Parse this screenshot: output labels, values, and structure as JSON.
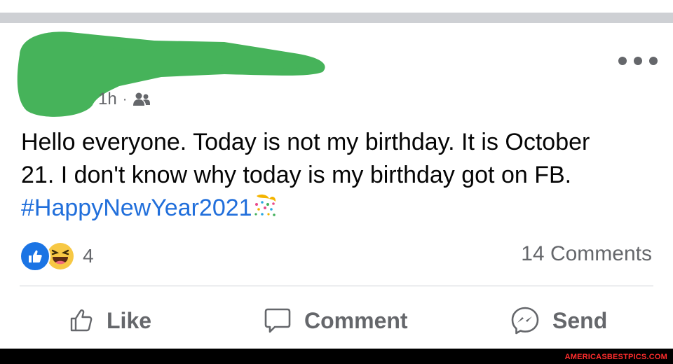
{
  "post": {
    "time": "1h",
    "separator": "·",
    "audience_icon": "friends-icon",
    "text_line1": "Hello everyone. Today is not my birthday. It is October",
    "text_line2": "21. I don't know why today is my birthday got on FB.",
    "hashtag": "#HappyNewYear2021",
    "hashtag_emoji": "confetti-icon"
  },
  "reactions": {
    "types": [
      "like",
      "haha"
    ],
    "count": "4"
  },
  "comments": {
    "count_label": "14 Comments"
  },
  "actions": {
    "like_label": "Like",
    "comment_label": "Comment",
    "send_label": "Send"
  },
  "watermark": "AMERICASBESTPICS.COM",
  "colors": {
    "link": "#216fdb",
    "secondary_text": "#65676b",
    "divider": "#ced0d4",
    "redaction": "#46b35a",
    "like_blue": "#1b74e4",
    "haha_yellow": "#f7c844",
    "watermark_red": "#ff2d2d"
  }
}
